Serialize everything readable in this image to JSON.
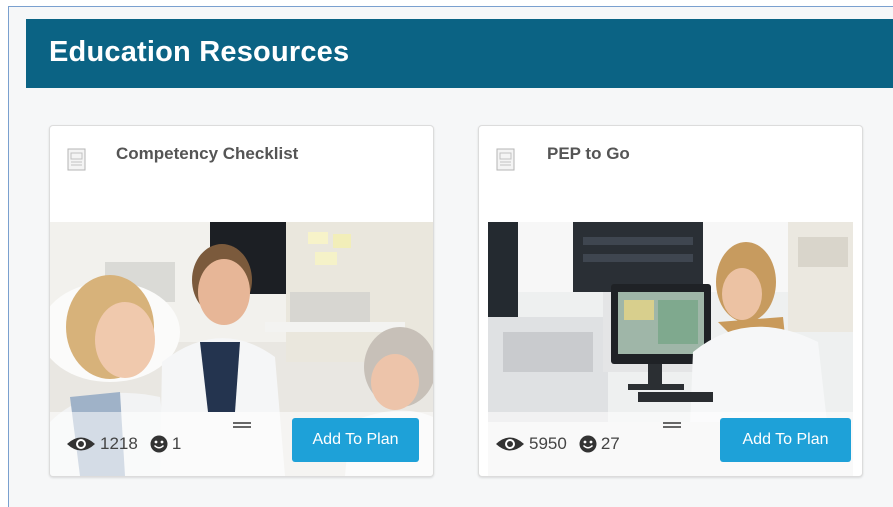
{
  "section": {
    "title": "Education Resources"
  },
  "colors": {
    "banner": "#0b6384",
    "button": "#1ea1d8"
  },
  "cards": [
    {
      "title": "Competency Checklist",
      "icon": "document-icon",
      "views": "1218",
      "likes": "1",
      "button_label": "Add To Plan"
    },
    {
      "title": "PEP to Go",
      "icon": "document-icon",
      "views": "5950",
      "likes": "27",
      "button_label": "Add To Plan"
    }
  ]
}
